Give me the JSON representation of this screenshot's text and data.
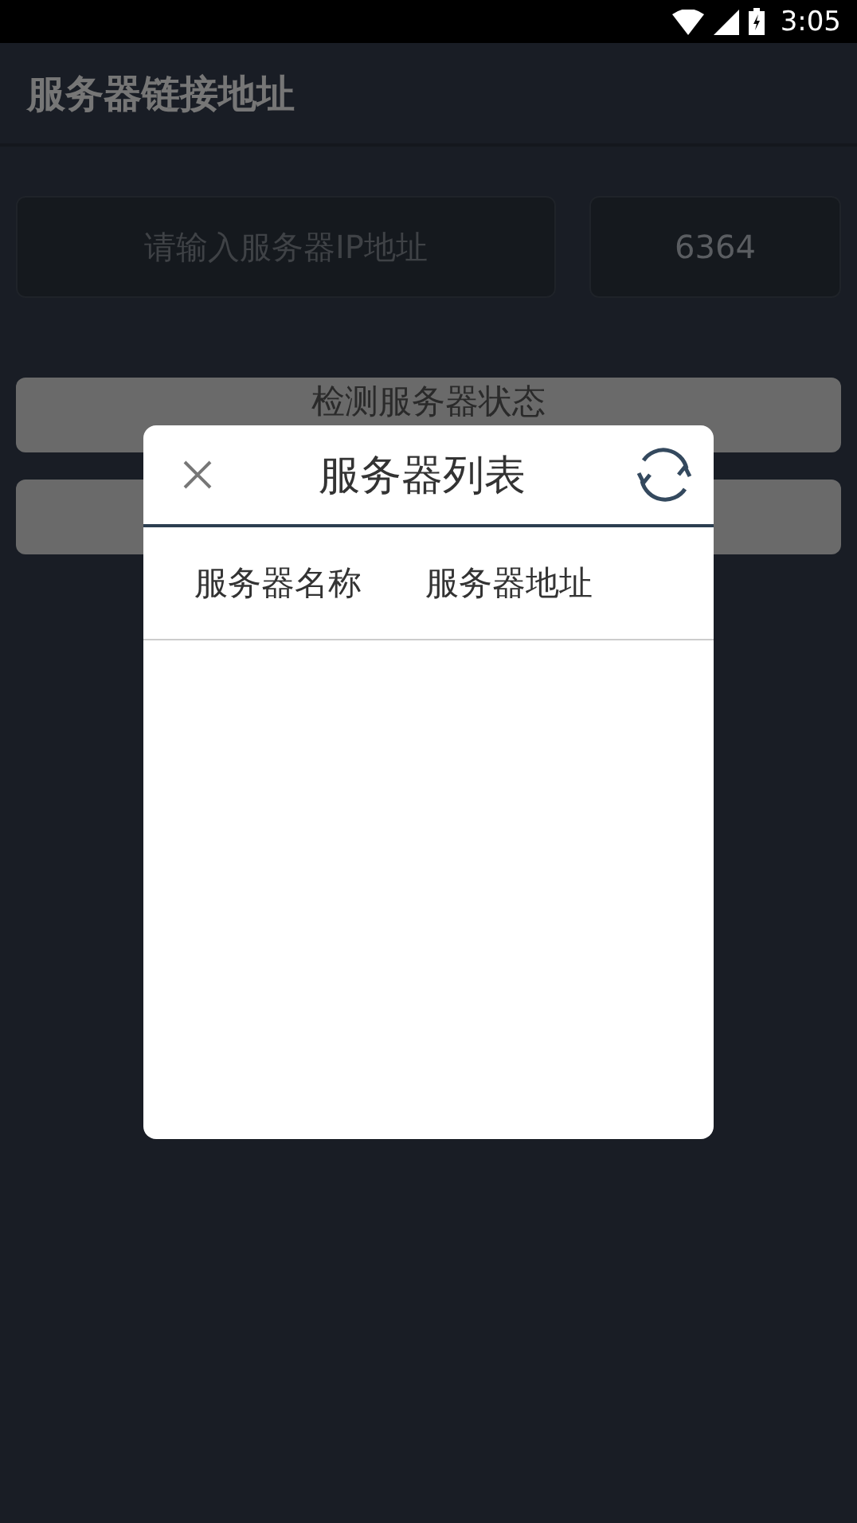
{
  "status_bar": {
    "time": "3:05"
  },
  "app_bar": {
    "title": "服务器链接地址"
  },
  "form": {
    "ip_field": {
      "placeholder": "请输入服务器IP地址"
    },
    "port_field": {
      "value": "6364"
    }
  },
  "buttons": [
    "检测服务器状态"
  ],
  "dialog": {
    "title": "服务器列表",
    "columns": [
      "服务器名称",
      "服务器地址"
    ]
  }
}
